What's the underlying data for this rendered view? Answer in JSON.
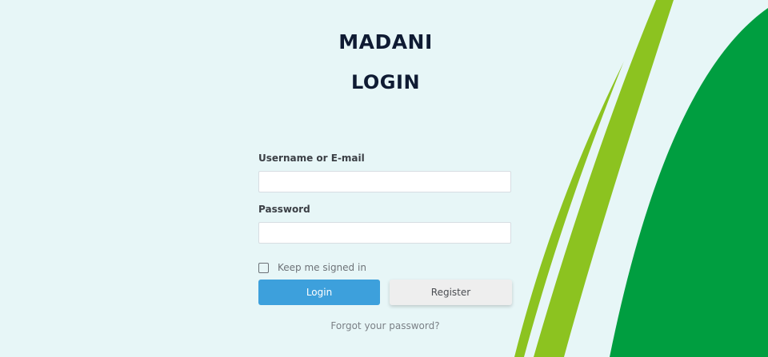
{
  "header": {
    "brand": "MADANI",
    "heading": "LOGIN"
  },
  "form": {
    "username_label": "Username or E-mail",
    "username_value": "",
    "password_label": "Password",
    "password_value": "",
    "remember_label": "Keep me signed in",
    "remember_checked": false,
    "login_button": "Login",
    "register_button": "Register",
    "forgot_link": "Forgot your password?"
  },
  "colors": {
    "background": "#e7f6f7",
    "heading": "#0f1b33",
    "login_button": "#3da0dc",
    "register_button": "#eeeeee",
    "decor_light_green": "#8cc320",
    "decor_dark_green": "#009e40"
  }
}
